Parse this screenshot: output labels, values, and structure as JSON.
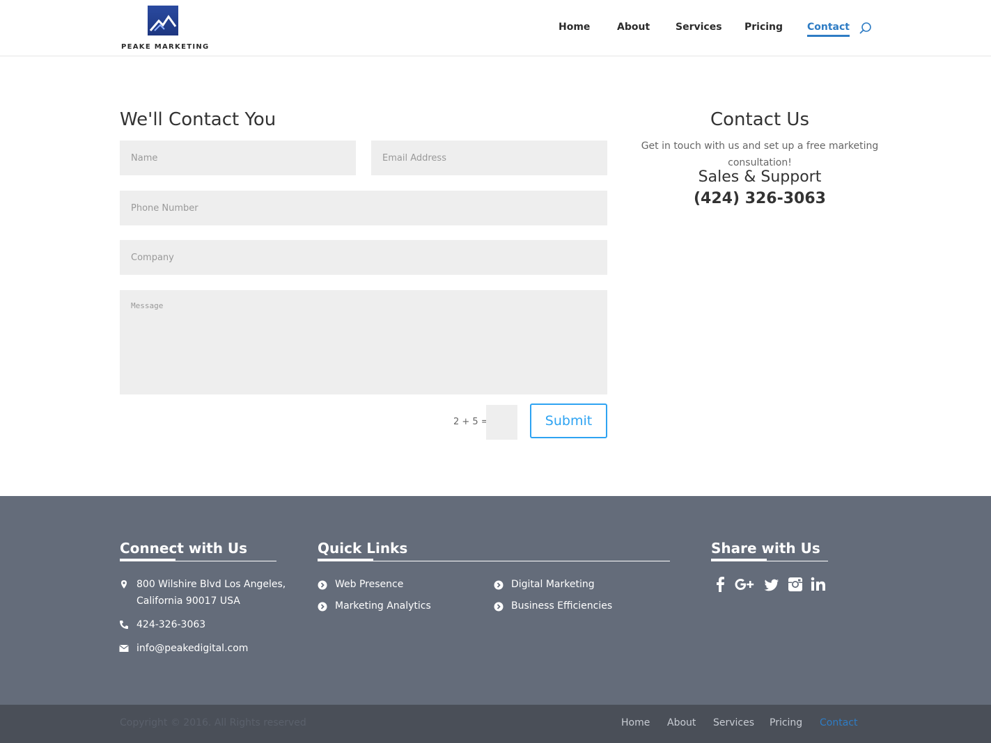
{
  "header": {
    "logo_text": "PEAKE MARKETING",
    "nav": [
      {
        "label": "Home"
      },
      {
        "label": "About"
      },
      {
        "label": "Services"
      },
      {
        "label": "Pricing"
      },
      {
        "label": "Contact",
        "active": true
      }
    ],
    "search_icon": "search-icon"
  },
  "form": {
    "title": "We'll Contact You",
    "name_placeholder": "Name",
    "email_placeholder": "Email Address",
    "phone_placeholder": "Phone Number",
    "company_placeholder": "Company",
    "message_placeholder": "Message",
    "captcha_label": "2 + 5 =",
    "submit_label": "Submit"
  },
  "contact": {
    "title": "Contact Us",
    "description": "Get in touch with us and set up a free marketing consultation!",
    "sales_label": "Sales & Support",
    "phone": "(424) 326-3063"
  },
  "footer": {
    "connect": {
      "title": "Connect with Us",
      "address_line1": "800 Wilshire Blvd Los Angeles,",
      "address_line2": "California 90017 USA",
      "phone": "424-326-3063",
      "email": "info@peakedigital.com"
    },
    "quick_links": {
      "title": "Quick Links",
      "items": [
        "Web Presence",
        "Marketing Analytics",
        "Digital Marketing",
        "Business Efficiencies"
      ]
    },
    "share": {
      "title": "Share with Us",
      "icons": [
        "facebook-icon",
        "google-plus-icon",
        "twitter-icon",
        "instagram-icon",
        "linkedin-icon"
      ]
    }
  },
  "bottom_bar": {
    "copyright": "Copyright © 2016. All Rights reserved",
    "nav": [
      {
        "label": "Home"
      },
      {
        "label": "About"
      },
      {
        "label": "Services"
      },
      {
        "label": "Pricing"
      },
      {
        "label": "Contact",
        "active": true
      }
    ]
  },
  "colors": {
    "accent": "#2e7cc4",
    "submit": "#2ea3f2",
    "footer_bg": "#646c7a",
    "bottom_bg": "#4a4f58",
    "field_bg": "#eeeeee"
  }
}
